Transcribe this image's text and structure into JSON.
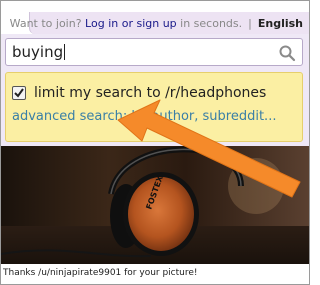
{
  "header": {
    "join_prompt": "Want to join?",
    "login_link": "Log in or sign up",
    "join_suffix": "in seconds.",
    "separator": "|",
    "language": "English"
  },
  "search": {
    "value": "buying",
    "restrict_checked": true,
    "restrict_label": "limit my search to /r/headphones",
    "advanced_label": "advanced search: by author, subreddit..."
  },
  "photo": {
    "credit": "Thanks /u/ninjapirate9901 for your picture!",
    "brand_text": "FOSTEX"
  },
  "colors": {
    "accent_arrow": "#f58a2a",
    "options_bg": "#fbefa3",
    "link": "#3a7fa6"
  }
}
